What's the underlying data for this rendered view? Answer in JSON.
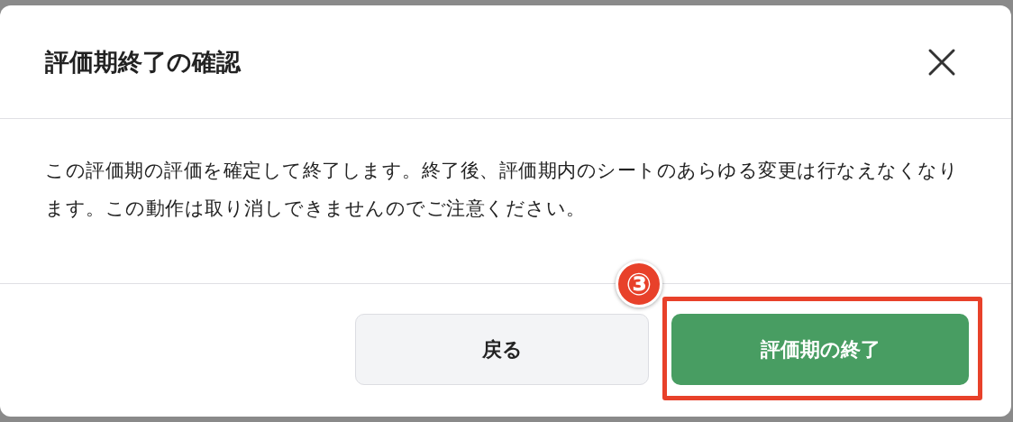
{
  "dialog": {
    "title": "評価期終了の確認",
    "message": "この評価期の評価を確定して終了します。終了後、評価期内のシートのあらゆる変更は行なえなくなります。この動作は取り消しできませんのでご注意ください。",
    "buttons": [
      {
        "label": "戻る",
        "kind": "secondary"
      },
      {
        "label": "評価期の終了",
        "kind": "primary"
      }
    ]
  },
  "annotation": {
    "badge": "③"
  }
}
